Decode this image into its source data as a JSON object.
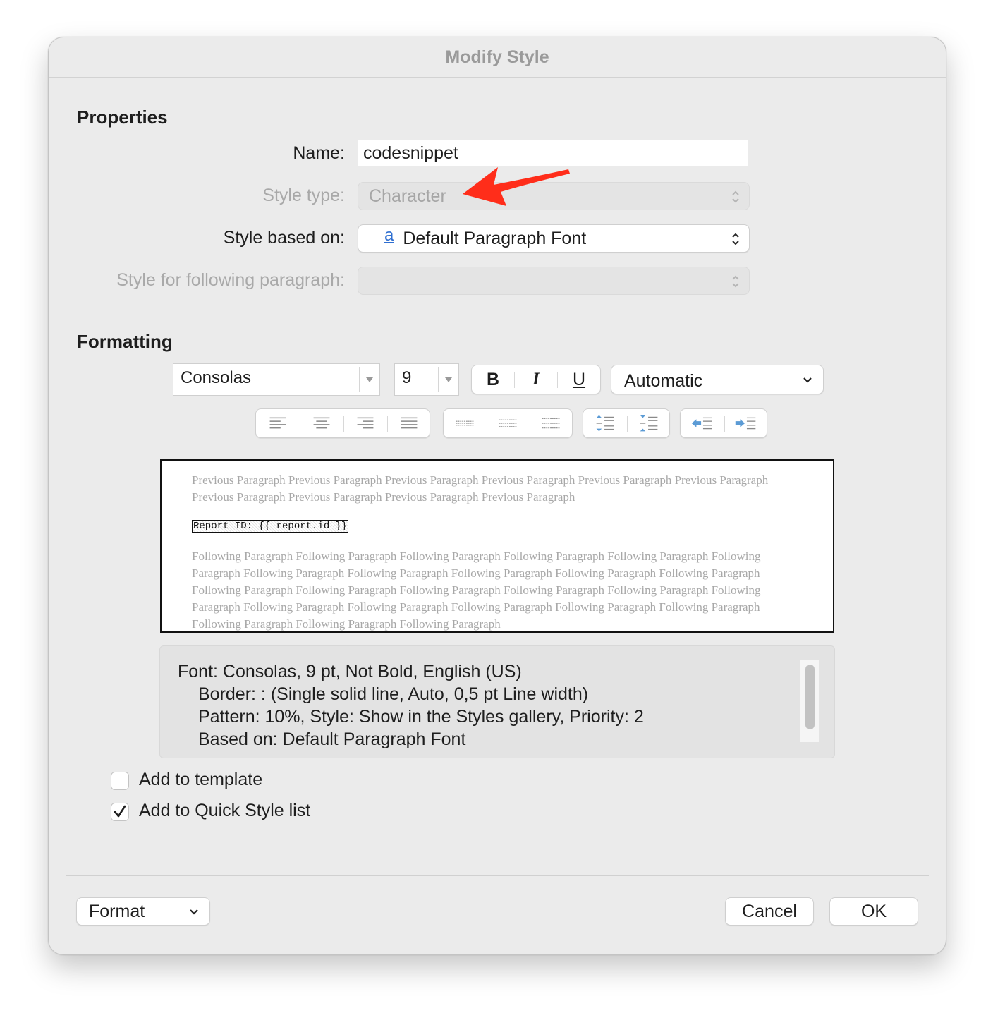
{
  "window": {
    "title": "Modify Style"
  },
  "properties": {
    "heading": "Properties",
    "name_label": "Name:",
    "name_value": "codesnippet",
    "style_type_label": "Style type:",
    "style_type_value": "Character",
    "based_on_label": "Style based on:",
    "based_on_icon_glyph": "a",
    "based_on_value": "Default Paragraph Font",
    "following_label": "Style for following paragraph:",
    "following_value": ""
  },
  "formatting": {
    "heading": "Formatting",
    "font": "Consolas",
    "size": "9",
    "bold_label": "B",
    "italic_label": "I",
    "underline_label": "U",
    "color": "Automatic"
  },
  "preview": {
    "previous_text": "Previous Paragraph Previous Paragraph Previous Paragraph Previous Paragraph Previous Paragraph Previous Paragraph Previous Paragraph Previous Paragraph Previous Paragraph Previous Paragraph",
    "sample_text": "Report ID: {{ report.id }}",
    "following_text": "Following Paragraph Following Paragraph Following Paragraph Following Paragraph Following Paragraph Following Paragraph Following Paragraph Following Paragraph Following Paragraph Following Paragraph Following Paragraph Following Paragraph Following Paragraph Following Paragraph Following Paragraph Following Paragraph Following Paragraph Following Paragraph Following Paragraph Following Paragraph Following Paragraph Following Paragraph Following Paragraph Following Paragraph Following Paragraph"
  },
  "description": {
    "line1": "Font: Consolas, 9 pt, Not Bold, English (US)",
    "line2": "Border: : (Single solid line, Auto,  0,5 pt Line width)",
    "line3": "Pattern: 10%, Style: Show in the Styles gallery, Priority: 2",
    "line4": "Based on: Default Paragraph Font"
  },
  "options": {
    "add_to_template_label": "Add to template",
    "add_to_template_checked": false,
    "add_to_quick_style_label": "Add to Quick Style list",
    "add_to_quick_style_checked": true
  },
  "footer": {
    "format_label": "Format",
    "cancel_label": "Cancel",
    "ok_label": "OK"
  },
  "colors": {
    "annotation_arrow": "#ff2d1a",
    "link_blue": "#2f6fd1",
    "disabled_text": "#a9a9a9"
  }
}
